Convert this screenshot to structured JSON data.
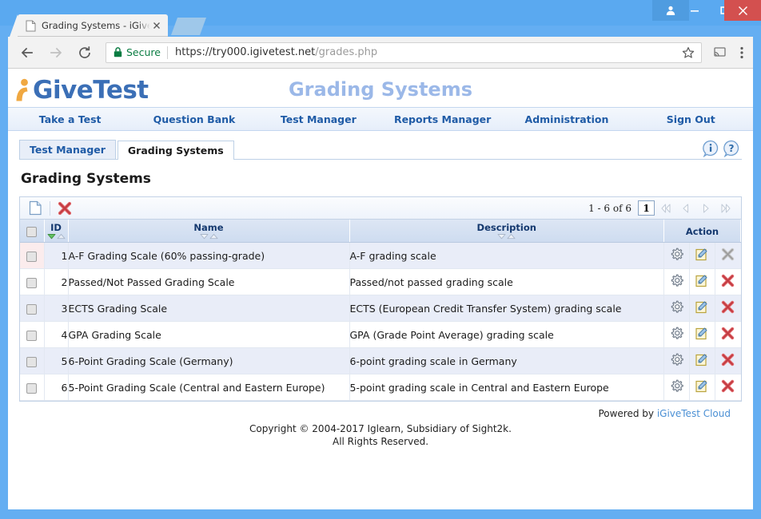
{
  "window": {
    "buttons": {
      "user": "user-account",
      "minimize": "minimize",
      "maximize": "maximize",
      "close": "close"
    }
  },
  "browser": {
    "tab": {
      "title": "Grading Systems - iGiveT",
      "close_label": "×"
    },
    "newtab_label": "",
    "omnibox": {
      "secure_label": "Secure",
      "url_domain": "https://try000.igivetest.net",
      "url_path": "/grades.php",
      "url_full": "https://try000.igivetest.net/grades.php"
    }
  },
  "site": {
    "logo_text": "GiveTest",
    "page_title": "Grading Systems",
    "nav": [
      {
        "label": "Take a Test"
      },
      {
        "label": "Question Bank"
      },
      {
        "label": "Test Manager"
      },
      {
        "label": "Reports Manager"
      },
      {
        "label": "Administration"
      },
      {
        "label": "Sign Out"
      }
    ],
    "subtabs": [
      {
        "label": "Test Manager",
        "active": false
      },
      {
        "label": "Grading Systems",
        "active": true
      }
    ],
    "section_title": "Grading Systems"
  },
  "grid": {
    "toolbar": {
      "new_icon": "new-document-icon",
      "delete_icon": "delete-icon"
    },
    "pager": {
      "count_text": "1 - 6 of 6",
      "page_value": "1",
      "first_label": "first-page",
      "prev_label": "previous-page",
      "next_label": "next-page",
      "last_label": "last-page"
    },
    "columns": [
      {
        "key": "check",
        "label": ""
      },
      {
        "key": "id",
        "label": "ID",
        "sort": "desc"
      },
      {
        "key": "name",
        "label": "Name",
        "sort": "none"
      },
      {
        "key": "description",
        "label": "Description",
        "sort": "none"
      },
      {
        "key": "action",
        "label": "Action",
        "sort": null
      }
    ],
    "rows": [
      {
        "id": "1",
        "name": "A-F Grading Scale (60% passing-grade)",
        "description": "A-F grading scale",
        "highlight": true,
        "delete_disabled": true
      },
      {
        "id": "2",
        "name": "Passed/Not Passed Grading Scale",
        "description": "Passed/not passed grading scale",
        "highlight": false,
        "delete_disabled": false
      },
      {
        "id": "3",
        "name": "ECTS Grading Scale",
        "description": "ECTS (European Credit Transfer System) grading scale",
        "highlight": false,
        "delete_disabled": false
      },
      {
        "id": "4",
        "name": "GPA Grading Scale",
        "description": "GPA (Grade Point Average) grading scale",
        "highlight": false,
        "delete_disabled": false
      },
      {
        "id": "5",
        "name": "6-Point Grading Scale (Germany)",
        "description": "6-point grading scale in Germany",
        "highlight": false,
        "delete_disabled": false
      },
      {
        "id": "6",
        "name": "5-Point Grading Scale (Central and Eastern Europe)",
        "description": "5-point grading scale in Central and Eastern Europe",
        "highlight": false,
        "delete_disabled": false
      }
    ],
    "row_actions": {
      "settings_icon": "gear-icon",
      "edit_icon": "edit-icon",
      "delete_icon": "delete-icon"
    }
  },
  "footer": {
    "powered_prefix": "Powered by ",
    "powered_link": "iGiveTest Cloud",
    "copyright_line1": "Copyright © 2004-2017 Iglearn, Subsidiary of Sight2k.",
    "copyright_line2": "All Rights Reserved."
  },
  "colors": {
    "window_blue": "#5aa9f0",
    "close_red": "#d3504f",
    "brand_blue": "#3b6fb6",
    "title_blue": "#9bb8e8",
    "nav_link": "#1f5ba6",
    "secure_green": "#0a7c42",
    "row_odd": "#e9edf8",
    "highlight_pink": "#fbeced",
    "link_blue": "#4a8fd4"
  }
}
